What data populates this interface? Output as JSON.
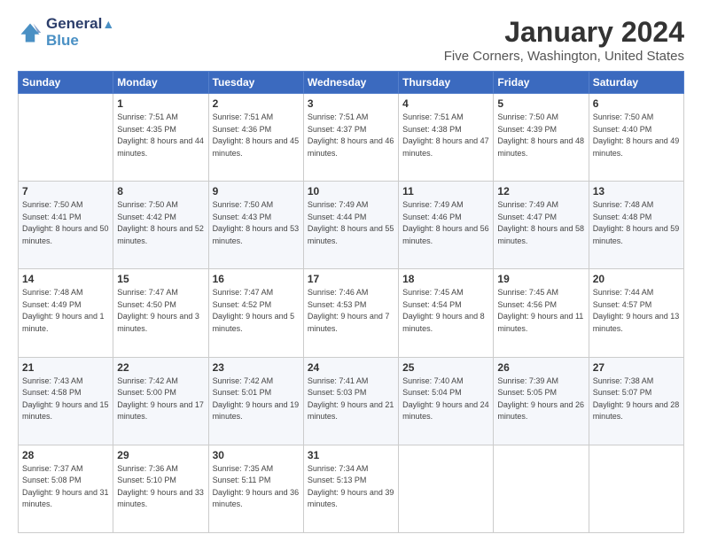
{
  "header": {
    "logo_line1": "General",
    "logo_line2": "Blue",
    "main_title": "January 2024",
    "subtitle": "Five Corners, Washington, United States"
  },
  "weekdays": [
    "Sunday",
    "Monday",
    "Tuesday",
    "Wednesday",
    "Thursday",
    "Friday",
    "Saturday"
  ],
  "weeks": [
    [
      {
        "day": "",
        "sunrise": "",
        "sunset": "",
        "daylight": ""
      },
      {
        "day": "1",
        "sunrise": "7:51 AM",
        "sunset": "4:35 PM",
        "daylight": "8 hours and 44 minutes."
      },
      {
        "day": "2",
        "sunrise": "7:51 AM",
        "sunset": "4:36 PM",
        "daylight": "8 hours and 45 minutes."
      },
      {
        "day": "3",
        "sunrise": "7:51 AM",
        "sunset": "4:37 PM",
        "daylight": "8 hours and 46 minutes."
      },
      {
        "day": "4",
        "sunrise": "7:51 AM",
        "sunset": "4:38 PM",
        "daylight": "8 hours and 47 minutes."
      },
      {
        "day": "5",
        "sunrise": "7:50 AM",
        "sunset": "4:39 PM",
        "daylight": "8 hours and 48 minutes."
      },
      {
        "day": "6",
        "sunrise": "7:50 AM",
        "sunset": "4:40 PM",
        "daylight": "8 hours and 49 minutes."
      }
    ],
    [
      {
        "day": "7",
        "sunrise": "7:50 AM",
        "sunset": "4:41 PM",
        "daylight": "8 hours and 50 minutes."
      },
      {
        "day": "8",
        "sunrise": "7:50 AM",
        "sunset": "4:42 PM",
        "daylight": "8 hours and 52 minutes."
      },
      {
        "day": "9",
        "sunrise": "7:50 AM",
        "sunset": "4:43 PM",
        "daylight": "8 hours and 53 minutes."
      },
      {
        "day": "10",
        "sunrise": "7:49 AM",
        "sunset": "4:44 PM",
        "daylight": "8 hours and 55 minutes."
      },
      {
        "day": "11",
        "sunrise": "7:49 AM",
        "sunset": "4:46 PM",
        "daylight": "8 hours and 56 minutes."
      },
      {
        "day": "12",
        "sunrise": "7:49 AM",
        "sunset": "4:47 PM",
        "daylight": "8 hours and 58 minutes."
      },
      {
        "day": "13",
        "sunrise": "7:48 AM",
        "sunset": "4:48 PM",
        "daylight": "8 hours and 59 minutes."
      }
    ],
    [
      {
        "day": "14",
        "sunrise": "7:48 AM",
        "sunset": "4:49 PM",
        "daylight": "9 hours and 1 minute."
      },
      {
        "day": "15",
        "sunrise": "7:47 AM",
        "sunset": "4:50 PM",
        "daylight": "9 hours and 3 minutes."
      },
      {
        "day": "16",
        "sunrise": "7:47 AM",
        "sunset": "4:52 PM",
        "daylight": "9 hours and 5 minutes."
      },
      {
        "day": "17",
        "sunrise": "7:46 AM",
        "sunset": "4:53 PM",
        "daylight": "9 hours and 7 minutes."
      },
      {
        "day": "18",
        "sunrise": "7:45 AM",
        "sunset": "4:54 PM",
        "daylight": "9 hours and 8 minutes."
      },
      {
        "day": "19",
        "sunrise": "7:45 AM",
        "sunset": "4:56 PM",
        "daylight": "9 hours and 11 minutes."
      },
      {
        "day": "20",
        "sunrise": "7:44 AM",
        "sunset": "4:57 PM",
        "daylight": "9 hours and 13 minutes."
      }
    ],
    [
      {
        "day": "21",
        "sunrise": "7:43 AM",
        "sunset": "4:58 PM",
        "daylight": "9 hours and 15 minutes."
      },
      {
        "day": "22",
        "sunrise": "7:42 AM",
        "sunset": "5:00 PM",
        "daylight": "9 hours and 17 minutes."
      },
      {
        "day": "23",
        "sunrise": "7:42 AM",
        "sunset": "5:01 PM",
        "daylight": "9 hours and 19 minutes."
      },
      {
        "day": "24",
        "sunrise": "7:41 AM",
        "sunset": "5:03 PM",
        "daylight": "9 hours and 21 minutes."
      },
      {
        "day": "25",
        "sunrise": "7:40 AM",
        "sunset": "5:04 PM",
        "daylight": "9 hours and 24 minutes."
      },
      {
        "day": "26",
        "sunrise": "7:39 AM",
        "sunset": "5:05 PM",
        "daylight": "9 hours and 26 minutes."
      },
      {
        "day": "27",
        "sunrise": "7:38 AM",
        "sunset": "5:07 PM",
        "daylight": "9 hours and 28 minutes."
      }
    ],
    [
      {
        "day": "28",
        "sunrise": "7:37 AM",
        "sunset": "5:08 PM",
        "daylight": "9 hours and 31 minutes."
      },
      {
        "day": "29",
        "sunrise": "7:36 AM",
        "sunset": "5:10 PM",
        "daylight": "9 hours and 33 minutes."
      },
      {
        "day": "30",
        "sunrise": "7:35 AM",
        "sunset": "5:11 PM",
        "daylight": "9 hours and 36 minutes."
      },
      {
        "day": "31",
        "sunrise": "7:34 AM",
        "sunset": "5:13 PM",
        "daylight": "9 hours and 39 minutes."
      },
      {
        "day": "",
        "sunrise": "",
        "sunset": "",
        "daylight": ""
      },
      {
        "day": "",
        "sunrise": "",
        "sunset": "",
        "daylight": ""
      },
      {
        "day": "",
        "sunrise": "",
        "sunset": "",
        "daylight": ""
      }
    ]
  ],
  "labels": {
    "sunrise": "Sunrise:",
    "sunset": "Sunset:",
    "daylight": "Daylight:"
  }
}
